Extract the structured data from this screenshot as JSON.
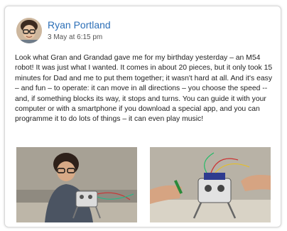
{
  "post": {
    "author": "Ryan Portland",
    "timestamp": "3 May at 6:15 pm",
    "body": "Look what Gran and Grandad gave me for my birthday yesterday – an M54 robot! It was just what I wanted. It comes in about 20 pieces, but it only took 15 minutes for Dad and me to put them together; it wasn't hard at all. And it's easy – and fun – to operate: it can move in all directions – you choose the speed -- and, if something blocks its way, it stops and turns. You can guide it with your computer or with a smartphone if you download a special app, and you can programme it to do lots of things – it can even play music!"
  },
  "colors": {
    "author_link": "#2c6fb7",
    "card_border": "#d9d9d9"
  }
}
